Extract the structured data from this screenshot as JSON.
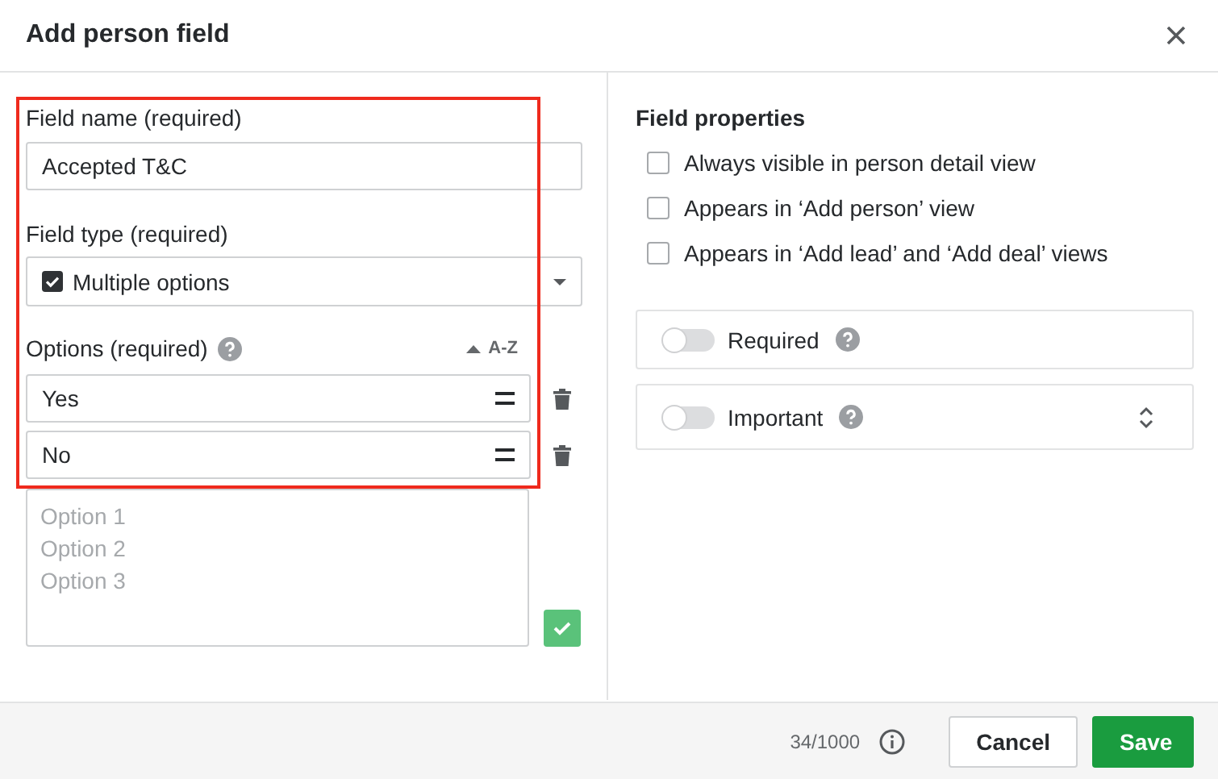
{
  "dialog": {
    "title": "Add person field"
  },
  "highlight_frame": {
    "shown": true
  },
  "field_name": {
    "label": "Field name (required)",
    "value": "Accepted T&C"
  },
  "field_type": {
    "label": "Field type (required)",
    "value": "Multiple options"
  },
  "options": {
    "label": "Options (required)",
    "sort": "A-Z",
    "items": [
      {
        "value": "Yes"
      },
      {
        "value": "No"
      }
    ],
    "new_options": {
      "placeholder": "Option 1\nOption 2\nOption 3"
    }
  },
  "field_properties": {
    "title": "Field properties",
    "checkboxes": [
      {
        "label": "Always visible in person detail view",
        "checked": false
      },
      {
        "label": "Appears in ‘Add person’ view",
        "checked": false
      },
      {
        "label": "Appears in ‘Add lead’ and ‘Add deal’ views",
        "checked": false
      }
    ],
    "toggles": [
      {
        "label": "Required",
        "on": false,
        "expandable": false
      },
      {
        "label": "Important",
        "on": false,
        "expandable": true
      }
    ]
  },
  "footer": {
    "counter": "34/1000",
    "buttons": [
      {
        "label": "Cancel",
        "kind": "secondary"
      },
      {
        "label": "Save",
        "kind": "primary"
      }
    ]
  }
}
